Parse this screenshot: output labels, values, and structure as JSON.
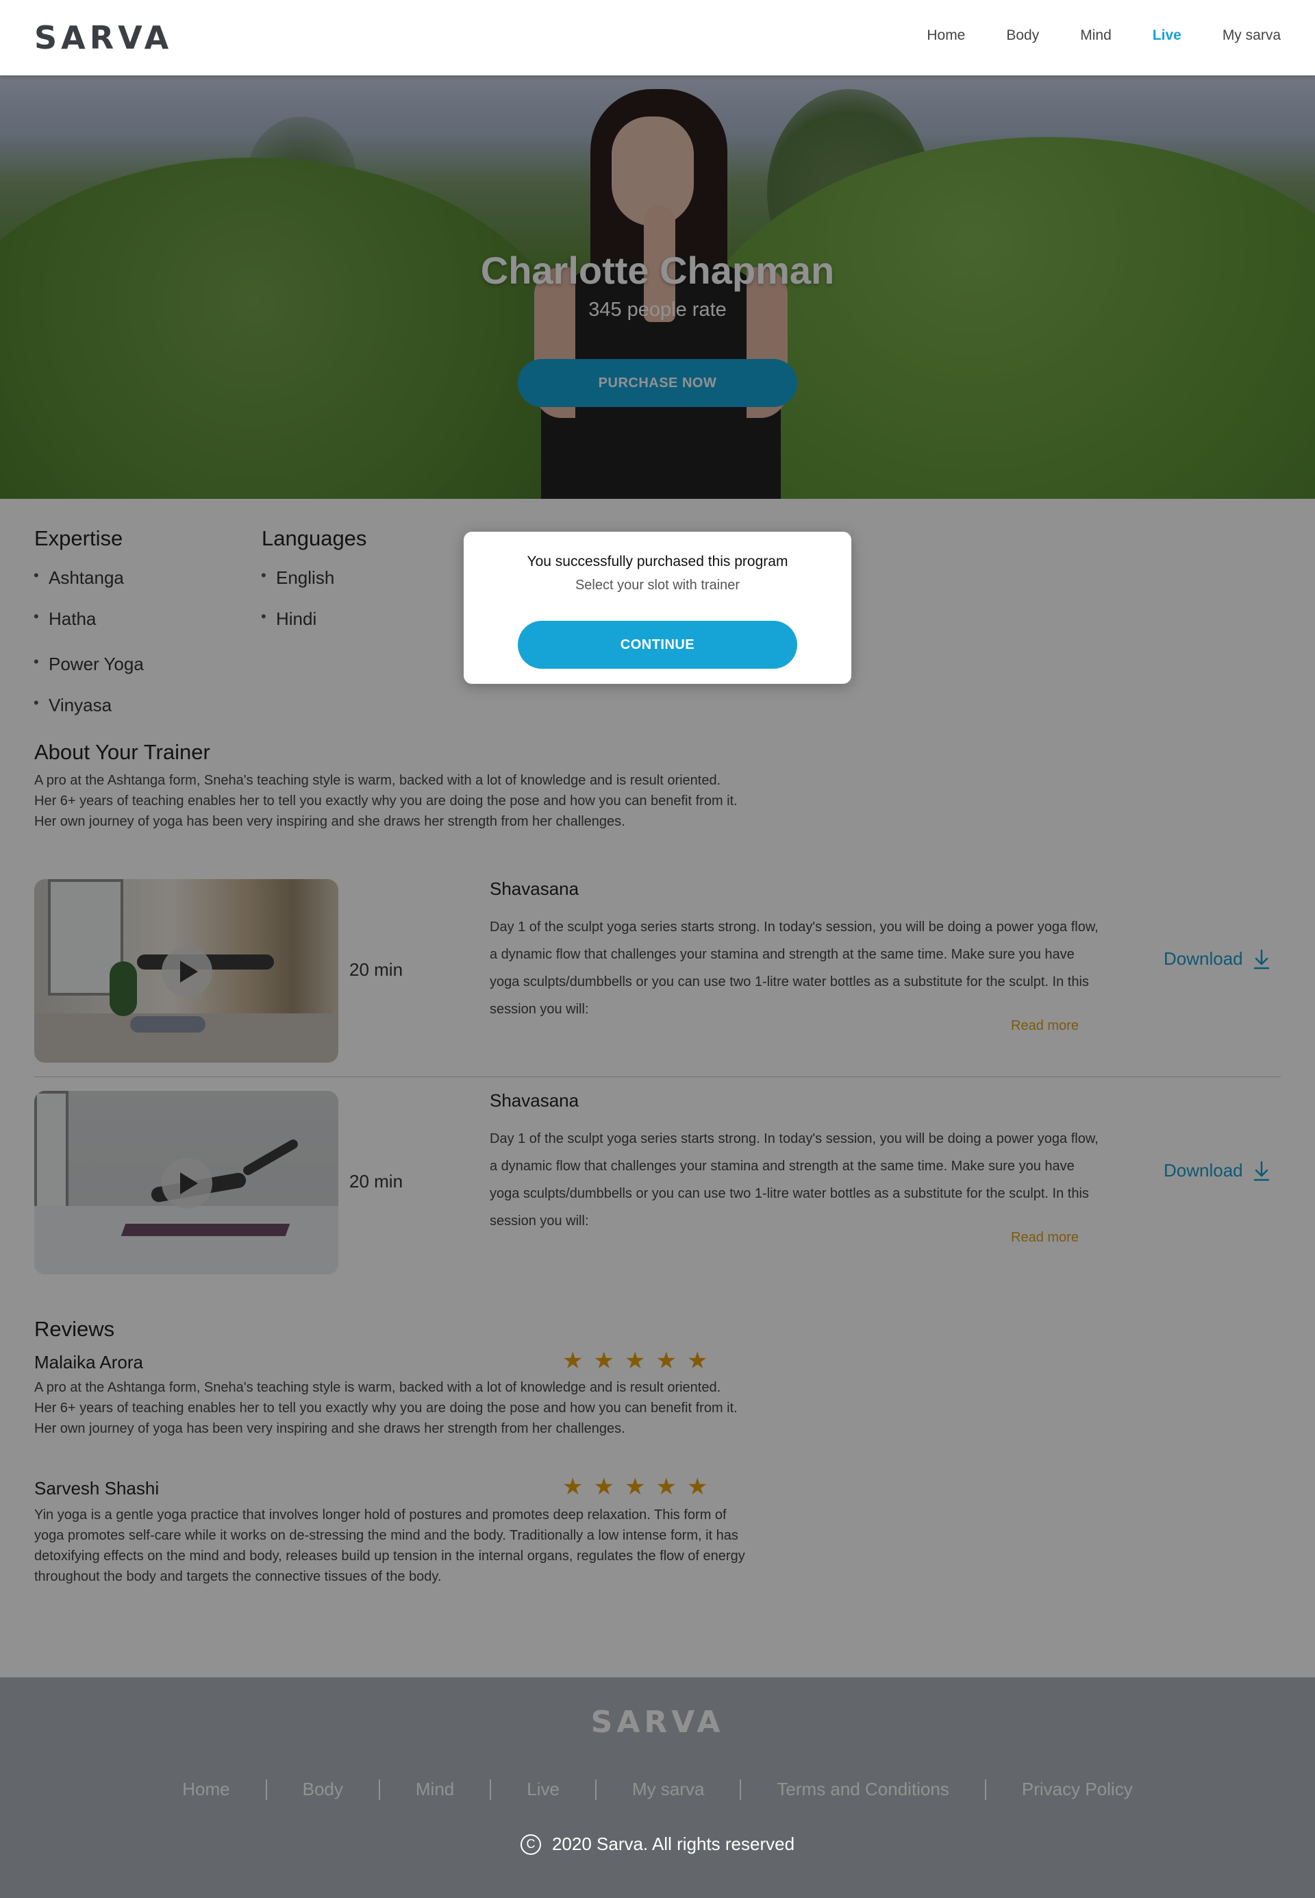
{
  "brand": {
    "logo_text": "SARVA",
    "accent": "#16a4d6",
    "logo_dot_colors": [
      "#e6a10f",
      "#8cc63f",
      "#16a4d6"
    ]
  },
  "nav": {
    "items": [
      "Home",
      "Body",
      "Mind",
      "Live",
      "My sarva"
    ],
    "active": "Live"
  },
  "hero": {
    "title": "Charlotte Chapman",
    "subtitle": "345 people rate",
    "cta": "PURCHASE NOW"
  },
  "expertise": {
    "heading": "Expertise",
    "items": [
      "Ashtanga",
      "Hatha",
      "Power Yoga",
      "Vinyasa"
    ]
  },
  "languages": {
    "heading": "Languages",
    "items": [
      "English",
      "Hindi"
    ]
  },
  "about": {
    "heading": "About Your Trainer",
    "text": "A pro at the Ashtanga form, Sneha's teaching style is warm, backed with a lot of knowledge and is result oriented. Her 6+ years of teaching enables her to tell you exactly why you are doing the pose and how you can benefit from it. Her own journey of yoga has been very inspiring and she draws her strength from her challenges."
  },
  "sessions": [
    {
      "duration": "20 min",
      "title": "Shavasana",
      "description": "Day 1 of the sculpt yoga series starts strong. In today's session, you will be doing a power yoga flow, a dynamic flow that challenges your stamina and strength at the same time. Make sure you have yoga sculpts/dumbbells or you can use two 1-litre water bottles as a substitute for the sculpt. In this session you will:",
      "read_more": "Read more",
      "download": "Download"
    },
    {
      "duration": "20 min",
      "title": "Shavasana",
      "description": "Day 1 of the sculpt yoga series starts strong. In today's session, you will be doing a power yoga flow, a dynamic flow that challenges your stamina and strength at the same time. Make sure you have yoga sculpts/dumbbells or you can use two 1-litre water bottles as a substitute for the sculpt. In this session you will:",
      "read_more": "Read more",
      "download": "Download"
    }
  ],
  "reviews": {
    "heading": "Reviews",
    "items": [
      {
        "name": "Malaika Arora",
        "rating": 5,
        "text": "A pro at the Ashtanga form, Sneha's teaching style is warm, backed with a lot of knowledge and is result oriented. Her 6+ years of teaching enables her to tell you exactly why you are doing the pose and how you can benefit from it. Her own journey of yoga has been very inspiring and she draws her strength from her challenges."
      },
      {
        "name": "Sarvesh Shashi",
        "rating": 5,
        "text": "Yin yoga is a gentle yoga practice that involves longer hold of postures and promotes deep relaxation. This form of yoga promotes self-care while it works on de-stressing the mind and the body. Traditionally a low intense form, it has detoxifying effects on the mind and body, releases build up tension in the internal organs, regulates the flow of energy throughout the body and targets the connective tissues of the body."
      }
    ]
  },
  "modal": {
    "title": "You successfully purchased this program",
    "subtitle": "Select your slot with trainer",
    "cta": "CONTINUE"
  },
  "footer": {
    "logo_text": "SARVA",
    "links": [
      "Home",
      "Body",
      "Mind",
      "Live",
      "My sarva",
      "Terms and Conditions",
      "Privacy Policy"
    ],
    "copyright_symbol": "C",
    "copyright": "2020 Sarva. All rights reserved"
  }
}
